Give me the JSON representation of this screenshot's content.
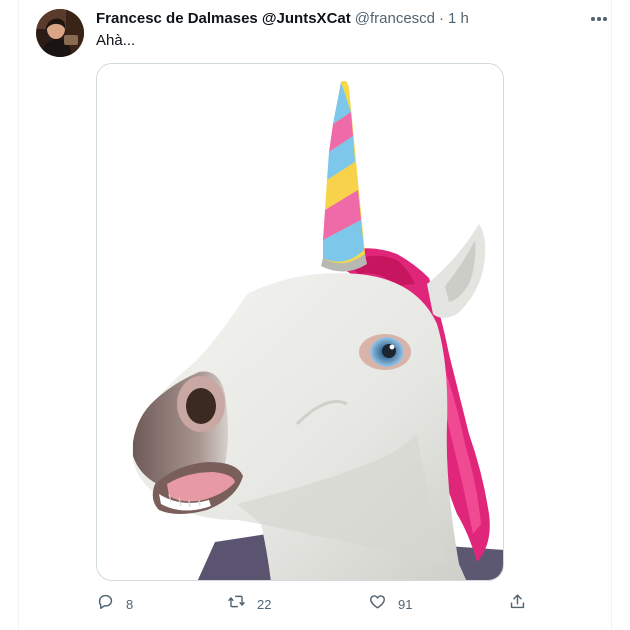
{
  "tweet": {
    "author_name": "Francesc de Dalmases @JuntsXCat",
    "handle": "@francescd",
    "separator": "·",
    "time": "1 h",
    "text": "Ahà..."
  },
  "actions": {
    "replies": "8",
    "retweets": "22",
    "likes": "91"
  },
  "icons": {
    "reply": "reply-icon",
    "retweet": "retweet-icon",
    "like": "heart-icon",
    "share": "share-icon",
    "more": "more-icon"
  },
  "colors": {
    "secondary_text": "#536471",
    "primary_text": "#0f1419",
    "border": "#cfd9de"
  }
}
